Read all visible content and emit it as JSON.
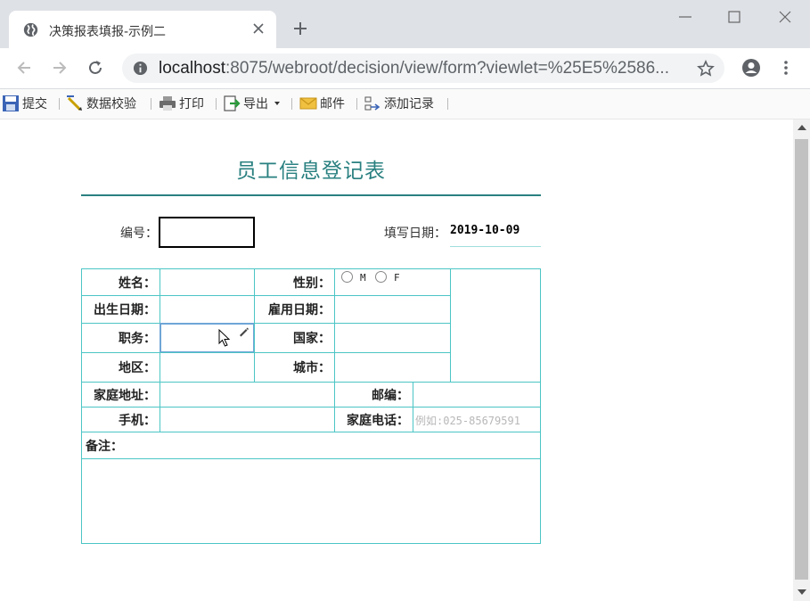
{
  "browser": {
    "tab_title": "决策报表填报-示例二",
    "url_host": "localhost",
    "url_path": ":8075/webroot/decision/view/form?viewlet=%25E5%2586..."
  },
  "toolbar": {
    "submit": "提交",
    "validate": "数据校验",
    "print": "打印",
    "export": "导出",
    "email": "邮件",
    "add_record": "添加记录"
  },
  "form": {
    "title": "员工信息登记表",
    "id_label": "编号：",
    "date_label": "填写日期：",
    "date_value": "2019-10-09",
    "fields": {
      "name": "姓名：",
      "gender": "性别：",
      "gender_m": "M",
      "gender_f": "F",
      "birth_date": "出生日期：",
      "hire_date": "雇用日期：",
      "position": "职务：",
      "country": "国家：",
      "region": "地区：",
      "city": "城市：",
      "home_address": "家庭地址：",
      "postcode": "邮编：",
      "mobile": "手机：",
      "home_phone": "家庭电话：",
      "home_phone_placeholder": "例如:025-85679591",
      "remarks": "备注："
    }
  },
  "colors": {
    "accent": "#2a8080",
    "table_border": "#4cc5c5",
    "active_border": "#6fa6d6"
  }
}
